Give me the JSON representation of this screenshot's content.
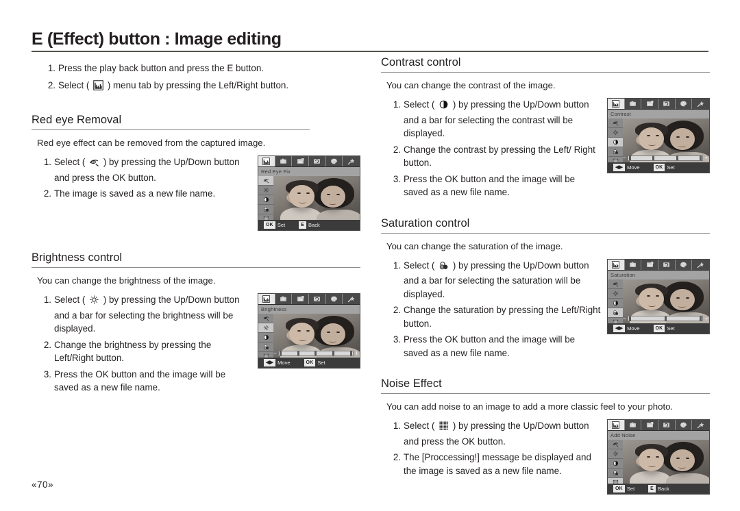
{
  "document": {
    "title": "E (Effect) button : Image editing",
    "page_number": "«70»"
  },
  "intro": {
    "steps": [
      {
        "num": "1.",
        "text_before": "Press the play back button and press the E button.",
        "icon": null
      },
      {
        "num": "2.",
        "text_before": "Select (",
        "icon": "histogram-menu-icon",
        "text_after": ") menu tab by pressing the Left/Right button."
      }
    ]
  },
  "sections": [
    {
      "id": "red-eye-removal",
      "heading": "Red eye Removal",
      "description": "Red eye effect can be removed from the captured image.",
      "steps": [
        {
          "num": "1.",
          "text_before": "Select (",
          "icon": "red-eye-icon",
          "text_after": ") by pressing the Up/Down button and press the OK button."
        },
        {
          "num": "2.",
          "text_before": "The image is saved as a new file name.",
          "icon": null
        }
      ],
      "lcd": {
        "title": "Red Eye Fix",
        "selected_side_index": 0,
        "has_slider": false,
        "commands": [
          {
            "key": "OK",
            "label": "Set"
          },
          {
            "key": "E",
            "label": "Back"
          }
        ]
      }
    },
    {
      "id": "brightness-control",
      "heading": "Brightness control",
      "description": "You can change the brightness of the image.",
      "steps": [
        {
          "num": "1.",
          "text_before": "Select (",
          "icon": "sun-brightness-icon",
          "text_after": ") by pressing the Up/Down button and a bar for selecting the brightness will be displayed."
        },
        {
          "num": "2.",
          "text_before": "Change the brightness by pressing the Left/Right  button.",
          "icon": null
        },
        {
          "num": "3.",
          "text_before": "Press the OK button and the image will be saved as a new file name.",
          "icon": null
        }
      ],
      "lcd": {
        "title": "Brightness",
        "selected_side_index": 1,
        "has_slider": true,
        "slider": {
          "minus": "−",
          "plus": "+",
          "knobs": 5,
          "value": 0
        },
        "commands": [
          {
            "key": "◀▶",
            "label": "Move"
          },
          {
            "key": "OK",
            "label": "Set"
          }
        ]
      }
    },
    {
      "id": "contrast-control",
      "heading": "Contrast control",
      "description": "You can change the contrast of the image.",
      "steps": [
        {
          "num": "1.",
          "text_before": "Select (",
          "icon": "contrast-icon",
          "text_after": ") by pressing the Up/Down button and a bar for selecting the contrast will be displayed."
        },
        {
          "num": "2.",
          "text_before": "Change the contrast by pressing the Left/ Right button.",
          "icon": null
        },
        {
          "num": "3.",
          "text_before": "Press the OK button and the image will be saved as a new file name.",
          "icon": null
        }
      ],
      "lcd": {
        "title": "Contrast",
        "selected_side_index": 2,
        "has_slider": true,
        "slider": {
          "minus": "−",
          "plus": "+",
          "knobs": 4,
          "value": 0
        },
        "commands": [
          {
            "key": "◀▶",
            "label": "Move"
          },
          {
            "key": "OK",
            "label": "Set"
          }
        ]
      }
    },
    {
      "id": "saturation-control",
      "heading": "Saturation control",
      "description": "You can change the saturation of the image.",
      "steps": [
        {
          "num": "1.",
          "text_before": "Select (",
          "icon": "saturation-icon",
          "text_after": ") by pressing the Up/Down button and a bar for selecting the saturation will be displayed."
        },
        {
          "num": "2.",
          "text_before": "Change the saturation by pressing the Left/Right button.",
          "icon": null
        },
        {
          "num": "3.",
          "text_before": "Press the OK button and the image will be saved as a new file name.",
          "icon": null
        }
      ],
      "lcd": {
        "title": "Saturation",
        "selected_side_index": 3,
        "has_slider": true,
        "slider": {
          "minus": "−",
          "plus": "+",
          "knobs": 3,
          "value": 0
        },
        "commands": [
          {
            "key": "◀▶",
            "label": "Move"
          },
          {
            "key": "OK",
            "label": "Set"
          }
        ]
      }
    },
    {
      "id": "noise-effect",
      "heading": "Noise Effect",
      "description": "You can add noise to an image to add a more classic feel to your photo.",
      "steps": [
        {
          "num": "1.",
          "text_before": "Select (",
          "icon": "noise-grid-icon",
          "text_after": ") by pressing the Up/Down button and press the OK button."
        },
        {
          "num": "2.",
          "text_before": "The [Proccessing!] message be displayed and the image is saved as a new file name.",
          "icon": null
        }
      ],
      "lcd": {
        "title": "Add Noise",
        "selected_side_index": 4,
        "has_slider": false,
        "commands": [
          {
            "key": "OK",
            "label": "Set"
          },
          {
            "key": "E",
            "label": "Back"
          }
        ]
      }
    }
  ],
  "lcd_common": {
    "tabs": [
      "histogram-tab-icon",
      "camera-tab-icon",
      "resize-tab-icon",
      "rotate-tab-icon",
      "palette-tab-icon",
      "effect-star-tab-icon"
    ],
    "active_tab_index": 0,
    "side_icons": [
      "red-eye-icon",
      "sun-brightness-icon",
      "contrast-icon",
      "saturation-icon",
      "noise-grid-icon"
    ]
  },
  "colors": {
    "text": "#231f20",
    "rule_title": "#56534f",
    "rule_section": "#8b8b8b",
    "lcd_bg": "#6f6f6f",
    "lcd_titlebar": "#a3a3a3",
    "lcd_cmdbar": "#3b3b3b"
  }
}
